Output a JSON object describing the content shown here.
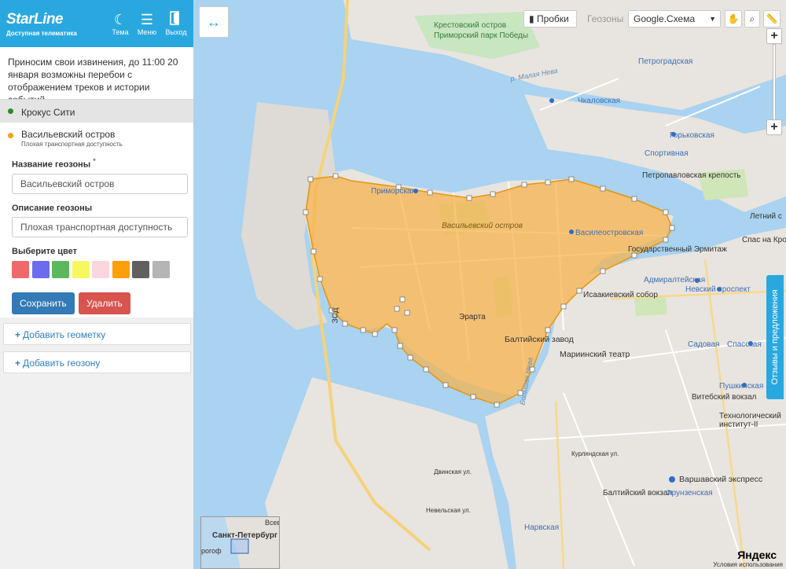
{
  "app": {
    "logo": "StarLine",
    "logo_subtitle": "Доступная телематика",
    "theme_label": "Тема",
    "menu_label": "Меню",
    "exit_label": "Выход"
  },
  "notice": "Приносим свои извинения, до 11:00 20 января возможны перебои с отображением треков и истории событий.",
  "geozones": [
    {
      "name": "Крокус Сити",
      "color": "#2a8a2a"
    },
    {
      "name": "Васильевский остров",
      "subtitle": "Плохая транспортная доступность",
      "color": "#f0a500"
    }
  ],
  "form": {
    "name_label": "Название геозоны",
    "required_mark": "*",
    "name_value": "Васильевский остров",
    "desc_label": "Описание геозоны",
    "desc_value": "Плохая транспортная доступность",
    "color_label": "Выберите цвет",
    "colors": [
      "#f0696a",
      "#6b6bf0",
      "#5cb85c",
      "#f7f75e",
      "#fbd6de",
      "#ff9f0a",
      "#606060",
      "#b5b5b5"
    ],
    "save_label": "Сохранить",
    "delete_label": "Удалить",
    "save_color": "#337ab7",
    "delete_color": "#d9534f"
  },
  "add_geometry": "Добавить геометку",
  "add_geozone": "Добавить геозону",
  "map": {
    "traffic_label": "Пробки",
    "geozones_label": "Геозоны",
    "map_type": "Google.Схема",
    "feedback": "Отзывы и предложения",
    "minimap_label": "Санкт-Петербург",
    "minimap_label2": "Всев",
    "minimap_label3": "рогоф",
    "yandex": "Яндекс",
    "copyright": "Условия использования",
    "labels": {
      "vasilievsky": "Васильевский остров",
      "erarta": "Эрарта",
      "baltic_plant": "Балтийский завод",
      "primorsky_park": "Приморский парк Победы",
      "krestovsky": "Крестовский остров",
      "petrogradskaya": "Петроградская",
      "chkalovskaya": "Чкаловская",
      "gorkovskaya": "Горьковская",
      "petropavlovsk": "Петропавловская крепость",
      "hermitage": "Государственный Эрмитаж",
      "admiralteyskaya": "Адмиралтейская",
      "nevsky": "Невский проспект",
      "isaac": "Исаакиевский собор",
      "mariinsky": "Мариинский театр",
      "sadovaya": "Садовая",
      "spasskaya": "Спасская",
      "pushkinskaya": "Пушкинская",
      "vitebsky": "Витебский вокзал",
      "tech_inst": "Технологический институт-II",
      "varshavsky": "Варшавский экспресс",
      "baltiysky": "Балтийский вокзал",
      "frunzenskaya": "Фрунзенская",
      "narvskaya": "Нарвская",
      "primorskaya": "Приморская",
      "vasileostrovskaya": "Василеостровская",
      "sportivnaya": "Спортивная",
      "spas": "Спас на Крови",
      "letniy": "Летний с",
      "zsd": "ЗСД",
      "malaya_neva": "р. Малая Нева",
      "bolshaya_neva": "Большая Нева",
      "kurlyandskaya": "Курляндская ул.",
      "dvinskaya": "Двинская ул.",
      "nevelskaya": "Невельская ул."
    }
  }
}
